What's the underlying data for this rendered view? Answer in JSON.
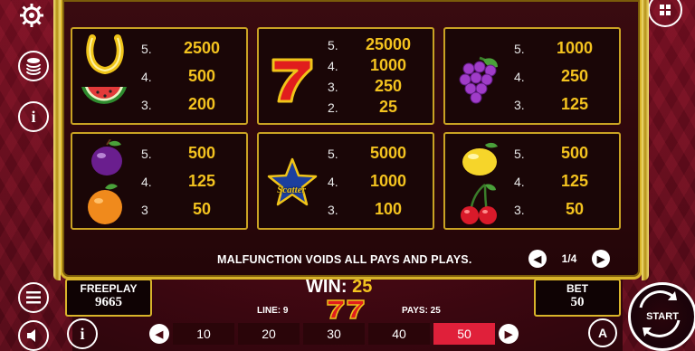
{
  "paytable": {
    "cards": [
      {
        "symbols": [
          "horseshoe-icon",
          "watermelon-icon"
        ],
        "pays": [
          [
            "5.",
            "2500"
          ],
          [
            "4.",
            "500"
          ],
          [
            "3.",
            "200"
          ]
        ]
      },
      {
        "symbols": [
          "seven-icon"
        ],
        "pays": [
          [
            "5.",
            "25000"
          ],
          [
            "4.",
            "1000"
          ],
          [
            "3.",
            "250"
          ],
          [
            "2.",
            "25"
          ]
        ]
      },
      {
        "symbols": [
          "grapes-icon"
        ],
        "pays": [
          [
            "5.",
            "1000"
          ],
          [
            "4.",
            "250"
          ],
          [
            "3.",
            "125"
          ]
        ]
      },
      {
        "symbols": [
          "plum-icon",
          "orange-icon"
        ],
        "pays": [
          [
            "5.",
            "500"
          ],
          [
            "4.",
            "125"
          ],
          [
            "3",
            "50"
          ]
        ]
      },
      {
        "symbols": [
          "scatter-star-icon"
        ],
        "scatter_label": "Scatter",
        "pays": [
          [
            "5.",
            "5000"
          ],
          [
            "4.",
            "1000"
          ],
          [
            "3.",
            "100"
          ]
        ]
      },
      {
        "symbols": [
          "lemon-icon",
          "cherries-icon"
        ],
        "pays": [
          [
            "5.",
            "500"
          ],
          [
            "4.",
            "125"
          ],
          [
            "3.",
            "50"
          ]
        ]
      }
    ],
    "malfunction": "MALFUNCTION VOIDS ALL PAYS AND PLAYS.",
    "page": "1/4"
  },
  "footer": {
    "freeplay_label": "FREEPLAY",
    "freeplay_value": "9665",
    "win_label": "WIN:",
    "win_value": "25",
    "line_label": "LINE: 9",
    "pays_label": "PAYS: 25",
    "bet_label": "BET",
    "bet_value": "50",
    "bet_options": [
      "10",
      "20",
      "30",
      "40",
      "50"
    ],
    "selected_bet": "50",
    "start_label": "START",
    "auto_label": "A"
  },
  "colors": {
    "gold": "#d8b42a",
    "amount": "#f3c21f",
    "selected": "#e0203a",
    "bg": "#3a0710"
  }
}
